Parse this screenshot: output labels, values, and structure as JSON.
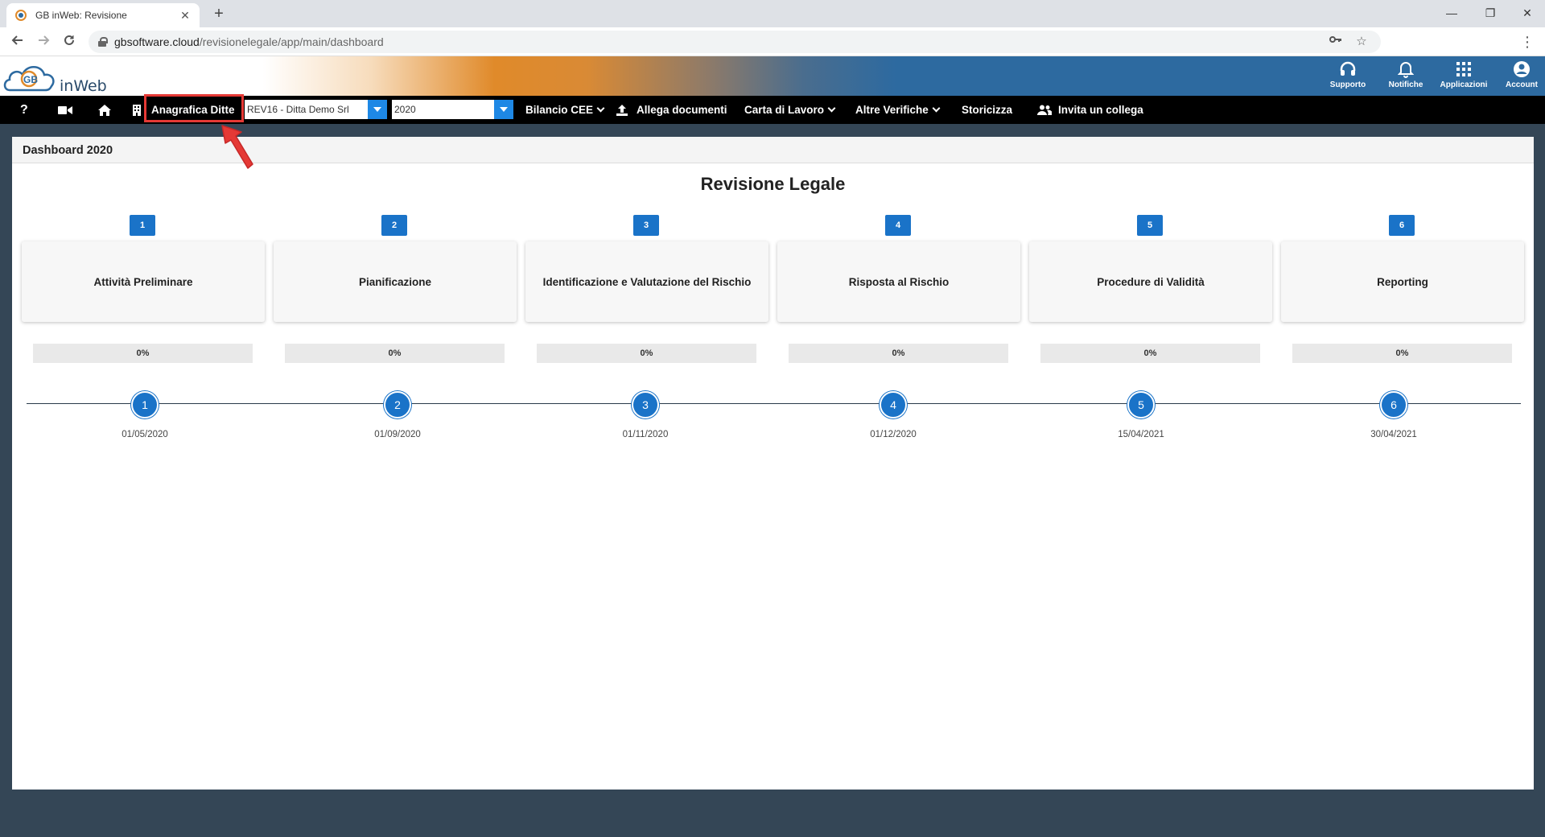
{
  "browser": {
    "tab_title": "GB inWeb: Revisione",
    "close_glyph": "✕",
    "newtab_glyph": "+",
    "url_host": "gbsoftware.cloud",
    "url_path": "/revisionelegale/app/main/dashboard",
    "minimize_glyph": "—",
    "restore_glyph": "❐",
    "close_window_glyph": "✕"
  },
  "header": {
    "logo_text": "inWeb",
    "icons": [
      {
        "label": "Supporto",
        "icon": "headset-icon"
      },
      {
        "label": "Notifiche",
        "icon": "bell-icon"
      },
      {
        "label": "Applicazioni",
        "icon": "grid-icon"
      },
      {
        "label": "Account",
        "icon": "account-icon"
      }
    ]
  },
  "toolbar": {
    "help": "?",
    "anagrafica": "Anagrafica Ditte",
    "company_select": "REV16 - Ditta Demo Srl",
    "year_select": "2020",
    "menu": {
      "bilancio": "Bilancio CEE",
      "allega": "Allega documenti",
      "carta": "Carta di Lavoro",
      "altre": "Altre Verifiche",
      "storicizza": "Storicizza",
      "invita": "Invita un collega"
    }
  },
  "panel": {
    "header": "Dashboard 2020",
    "title": "Revisione Legale"
  },
  "phases": [
    {
      "num": "1",
      "label": "Attività Preliminare",
      "progress": "0%",
      "progress_value": 0
    },
    {
      "num": "2",
      "label": "Pianificazione",
      "progress": "0%",
      "progress_value": 0
    },
    {
      "num": "3",
      "label": "Identificazione e Valutazione del Rischio",
      "progress": "0%",
      "progress_value": 0
    },
    {
      "num": "4",
      "label": "Risposta al Rischio",
      "progress": "0%",
      "progress_value": 0
    },
    {
      "num": "5",
      "label": "Procedure di Validità",
      "progress": "0%",
      "progress_value": 0
    },
    {
      "num": "6",
      "label": "Reporting",
      "progress": "0%",
      "progress_value": 0
    }
  ],
  "timeline": [
    {
      "num": "1",
      "date": "01/05/2020"
    },
    {
      "num": "2",
      "date": "01/09/2020"
    },
    {
      "num": "3",
      "date": "01/11/2020"
    },
    {
      "num": "4",
      "date": "01/12/2020"
    },
    {
      "num": "5",
      "date": "15/04/2021"
    },
    {
      "num": "6",
      "date": "30/04/2021"
    }
  ],
  "colors": {
    "accent": "#1a73c8",
    "toolbar": "#000000",
    "header_blue": "#2d6aa0",
    "highlight": "#e53935",
    "background": "#344656"
  }
}
